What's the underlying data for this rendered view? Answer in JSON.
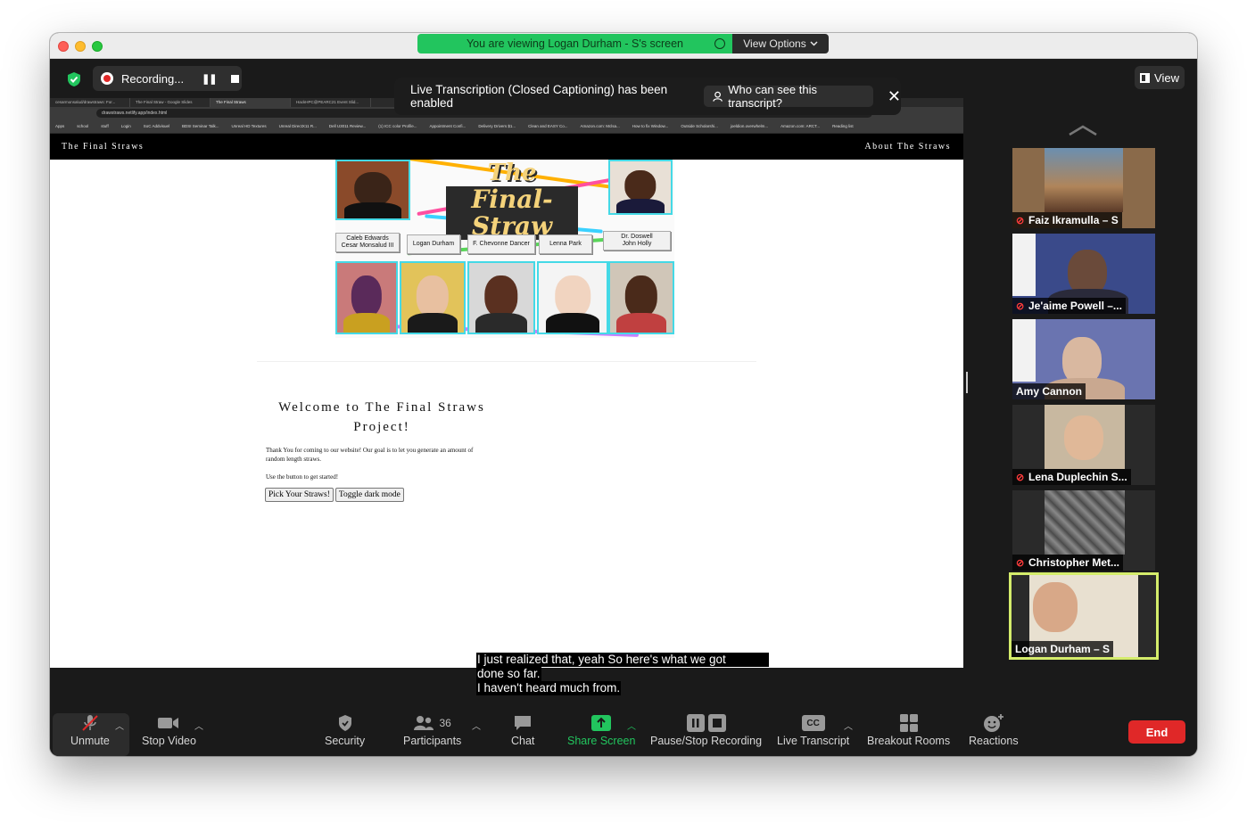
{
  "window": {
    "viewing_banner": "You are viewing Logan Durham - S's screen",
    "view_options_label": "View Options"
  },
  "topbar": {
    "recording_label": "Recording...",
    "view_label": "View"
  },
  "transcript_banner": {
    "message": "Live Transcription (Closed Captioning) has been enabled",
    "who_label": "Who can see this transcript?"
  },
  "browser": {
    "tabs": [
      "cesarmonsalud/drawstraws: For...",
      "The Final Straw - Google Slides",
      "The Final Straws",
      "HackHPC@PEARC21 Event Slid..."
    ],
    "url": "drawstraws.netlify.app/index.html",
    "bookmarks": [
      "Apps",
      "school",
      "stuff",
      "Login",
      "SoC Addvisuel",
      "BDSI Seminar Talk...",
      "Unreal HD Textures",
      "Unreal DirectX11 R...",
      "Dell U3011 Review...",
      "(1) ICC color Profile...",
      "Appointment Confi...",
      "Delivery Drivers $1...",
      "Clean and EASY Co...",
      "Amazon.com: Mclsa...",
      "How to fix Window...",
      "Outside Scholarshi...",
      "joeldion.overwhelm...",
      "Amazon.com: ARCT..."
    ],
    "reading_list": "Reading list"
  },
  "website": {
    "brand": "The Final Straws",
    "nav_about": "About The Straws",
    "graphic_title_line1": "The",
    "graphic_title_line2": "Final-Straw",
    "name_cards": [
      "Caleb Edwards\nCesar Monsalud III",
      "Logan Durham",
      "F. Chevonne Dancer",
      "Lenna Park",
      "Dr. Doswell\nJohn Holly"
    ],
    "welcome_title": "Welcome to The Final Straws Project!",
    "intro": "Thank You for coming to our website! Our goal is to let you generate an amount of random length straws.",
    "instruction": "Use the button to get started!",
    "pick_button": "Pick Your Straws!",
    "dark_button": "Toggle dark mode"
  },
  "captions": {
    "line1": "I just realized that, yeah So here's what we got",
    "line2": "done so far.",
    "line3": "I haven't heard much from."
  },
  "participants": [
    {
      "name": "Faiz Ikramulla – S",
      "muted": true
    },
    {
      "name": "Je'aime Powell –...",
      "muted": true
    },
    {
      "name": "Amy Cannon",
      "muted": false
    },
    {
      "name": "Lena Duplechin S...",
      "muted": true
    },
    {
      "name": "Christopher Met...",
      "muted": true
    },
    {
      "name": "Logan Durham – S",
      "muted": false,
      "active": true
    }
  ],
  "toolbar": {
    "unmute": "Unmute",
    "stop_video": "Stop Video",
    "security": "Security",
    "participants": "Participants",
    "participant_count": "36",
    "chat": "Chat",
    "share_screen": "Share Screen",
    "pause_stop_recording": "Pause/Stop Recording",
    "cc_badge": "CC",
    "live_transcript": "Live Transcript",
    "breakout_rooms": "Breakout Rooms",
    "reactions": "Reactions",
    "end": "End"
  },
  "colors": {
    "banner_green": "#22c55e",
    "end_red": "#e02828",
    "active_speaker": "#d4ec6b"
  }
}
